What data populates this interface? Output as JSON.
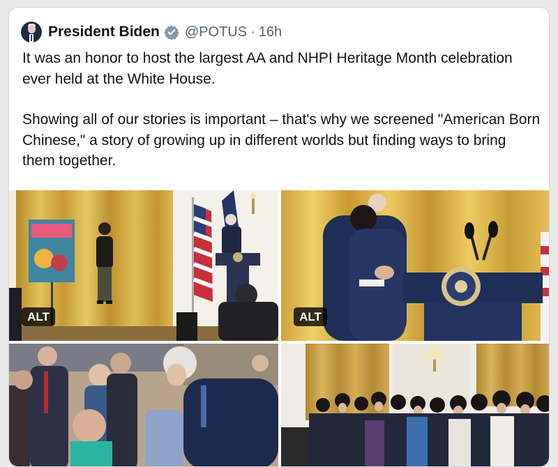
{
  "tweet": {
    "author_name": "President Biden",
    "verified_icon": "verified-badge-icon",
    "handle": "@POTUS",
    "separator": "·",
    "time": "16h",
    "paragraph_1": "It was an honor to host the largest AA and NHPI Heritage Month celebration ever held at the White House.",
    "paragraph_2": "Showing all of our stories is important – that's why we screened \"American Born Chinese,\" a story of growing up in different worlds but finding ways to bring them together."
  },
  "media": {
    "alt_label_1": "ALT",
    "alt_label_2": "ALT"
  },
  "colors": {
    "text": "#0f1419",
    "secondary_text": "#536471",
    "verified_badge": "#829aab",
    "border": "#cfd9de",
    "gold_curtain": "#d6ac3c"
  }
}
